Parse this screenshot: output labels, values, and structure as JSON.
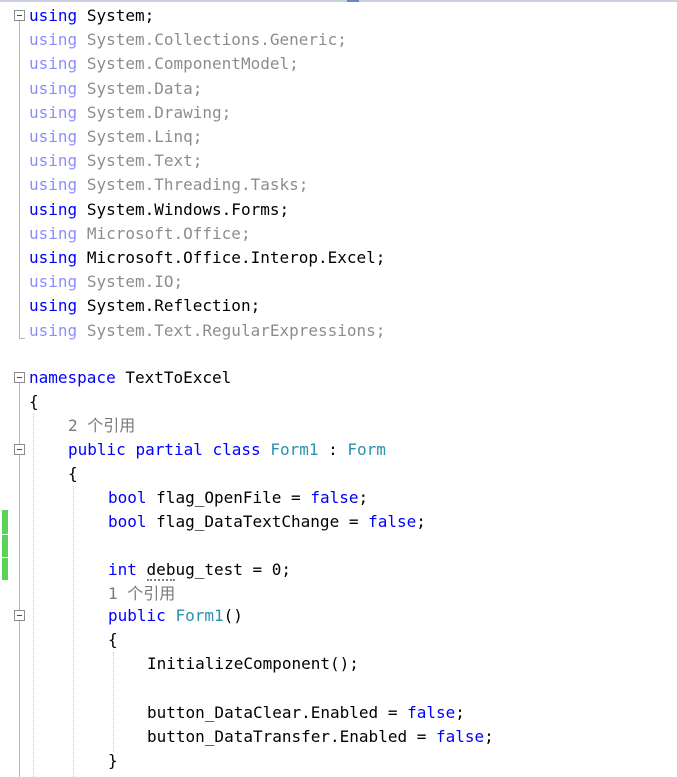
{
  "code": {
    "usings": [
      {
        "keyword": "using",
        "ns": "System;",
        "faded": false
      },
      {
        "keyword": "using",
        "ns": "System.Collections.Generic;",
        "faded": true
      },
      {
        "keyword": "using",
        "ns": "System.ComponentModel;",
        "faded": true
      },
      {
        "keyword": "using",
        "ns": "System.Data;",
        "faded": true
      },
      {
        "keyword": "using",
        "ns": "System.Drawing;",
        "faded": true
      },
      {
        "keyword": "using",
        "ns": "System.Linq;",
        "faded": true
      },
      {
        "keyword": "using",
        "ns": "System.Text;",
        "faded": true
      },
      {
        "keyword": "using",
        "ns": "System.Threading.Tasks;",
        "faded": true
      },
      {
        "keyword": "using",
        "ns": "System.Windows.Forms;",
        "faded": false
      },
      {
        "keyword": "using",
        "ns": "Microsoft.Office;",
        "faded": true
      },
      {
        "keyword": "using",
        "ns": "Microsoft.Office.Interop.Excel;",
        "faded": false
      },
      {
        "keyword": "using",
        "ns": "System.IO;",
        "faded": true
      },
      {
        "keyword": "using",
        "ns": "System.Reflection;",
        "faded": false
      },
      {
        "keyword": "using",
        "ns": "System.Text.RegularExpressions;",
        "faded": true
      }
    ],
    "namespace": {
      "keyword": "namespace",
      "name": "TextToExcel"
    },
    "open_brace": "{",
    "close_brace": "}",
    "class_refs": "2 个引用",
    "class_decl": {
      "kw1": "public",
      "kw2": "partial",
      "kw3": "class",
      "name": "Form1",
      "sep": " : ",
      "base": "Form"
    },
    "fields": [
      {
        "type": "bool",
        "name": "flag_OpenFile",
        "op": " = ",
        "value": "false",
        "end": ";"
      },
      {
        "type": "bool",
        "name": "flag_DataTextChange",
        "op": " = ",
        "value": "false",
        "end": ";"
      }
    ],
    "debug_field": {
      "type": "int",
      "name_underlined": "deb",
      "name_rest": "ug_test",
      "rest": " = 0;"
    },
    "ctor_refs": "1 个引用",
    "ctor_decl": {
      "kw": "public",
      "name": "Form1",
      "parens": "()"
    },
    "ctor_body": {
      "init": "InitializeComponent();",
      "stmt1": {
        "target": "button_DataClear.Enabled",
        "op": " = ",
        "value": "false",
        "end": ";"
      },
      "stmt2": {
        "target": "button_DataTransfer.Enabled",
        "op": " = ",
        "value": "false",
        "end": ";"
      }
    },
    "colors": {
      "keyword": "#0000ff",
      "type": "#2b91af",
      "change_bar": "#5bd35b"
    },
    "icons": [
      "collapse-icon",
      "change-indicator"
    ]
  }
}
